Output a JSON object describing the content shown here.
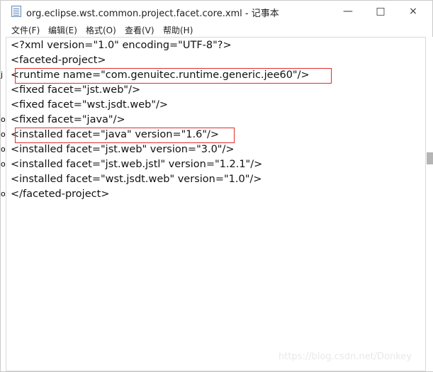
{
  "window": {
    "title": "org.eclipse.wst.common.project.facet.core.xml - 记事本",
    "icon": "notepad-icon",
    "controls": {
      "minimize": "—",
      "maximize": "□",
      "close": "×"
    }
  },
  "menu": {
    "items": [
      {
        "label": "文件(F)"
      },
      {
        "label": "编辑(E)"
      },
      {
        "label": "格式(O)"
      },
      {
        "label": "查看(V)"
      },
      {
        "label": "帮助(H)"
      }
    ]
  },
  "editor": {
    "lines": [
      "<?xml version=\"1.0\" encoding=\"UTF-8\"?>",
      "<faceted-project>",
      "  <runtime name=\"com.genuitec.runtime.generic.jee60\"/>",
      "  <fixed facet=\"jst.web\"/>",
      "  <fixed facet=\"wst.jsdt.web\"/>",
      "  <fixed facet=\"java\"/>",
      "  <installed facet=\"java\" version=\"1.6\"/>",
      "  <installed facet=\"jst.web\" version=\"3.0\"/>",
      "  <installed facet=\"jst.web.jstl\" version=\"1.2.1\"/>",
      "  <installed facet=\"wst.jsdt.web\" version=\"1.0\"/>",
      "</faceted-project>"
    ],
    "highlight_color": "#e22c2c"
  },
  "left_panel": {
    "fragments": [
      "j",
      "o",
      "o",
      "o",
      "o",
      "o"
    ]
  },
  "watermark": {
    "text": "https://blog.csdn.net/Donkey"
  }
}
